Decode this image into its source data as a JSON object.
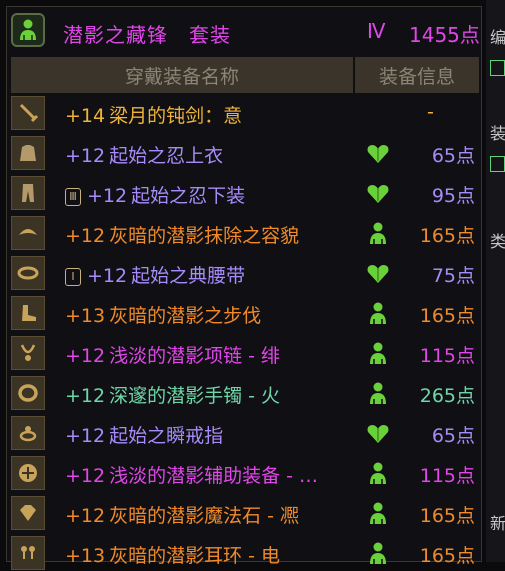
{
  "set": {
    "title": "潜影之藏锋　套装",
    "grade": "Ⅳ",
    "points": "1455点",
    "icon": "green-figure-icon",
    "color": "#e046e8"
  },
  "columns": {
    "name": "穿戴装备名称",
    "info": "装备信息"
  },
  "items": [
    {
      "slot": "weapon",
      "enh": "+14",
      "name": "梁月的钝剑：意",
      "info": "none",
      "points": "-",
      "color": "#f0b33a",
      "pcolor": "#f0b33a"
    },
    {
      "slot": "coat",
      "enh": "+12",
      "name": "起始之忍上衣",
      "info": "heart",
      "points": "65点",
      "color": "#a78bfa",
      "pcolor": "#a78bfa"
    },
    {
      "slot": "pants",
      "lock": "Ⅲ",
      "enh": "+12",
      "name": "起始之忍下装",
      "info": "heart",
      "points": "95点",
      "color": "#a78bfa",
      "pcolor": "#a78bfa"
    },
    {
      "slot": "shoulder",
      "enh": "+12",
      "name": "灰暗的潜影抹除之容貌",
      "info": "figure",
      "points": "165点",
      "color": "#f08a2a",
      "pcolor": "#f08a2a"
    },
    {
      "slot": "belt",
      "lock": "Ⅰ",
      "enh": "+12",
      "name": "起始之典腰带",
      "info": "heart",
      "points": "75点",
      "color": "#a78bfa",
      "pcolor": "#a78bfa"
    },
    {
      "slot": "shoes",
      "enh": "+13",
      "name": "灰暗的潜影之步伐",
      "info": "figure",
      "points": "165点",
      "color": "#f08a2a",
      "pcolor": "#f08a2a"
    },
    {
      "slot": "necklace",
      "enh": "+12",
      "name": "浅淡的潜影项链 - 绯",
      "info": "figure",
      "points": "115点",
      "color": "#e046e8",
      "pcolor": "#e046e8"
    },
    {
      "slot": "bracelet",
      "enh": "+12",
      "name": "深邃的潜影手镯 - 火",
      "info": "figure",
      "points": "265点",
      "color": "#6fd6a8",
      "pcolor": "#6fd6a8"
    },
    {
      "slot": "ring",
      "enh": "+12",
      "name": "起始之瞬戒指",
      "info": "heart",
      "points": "65点",
      "color": "#a78bfa",
      "pcolor": "#a78bfa"
    },
    {
      "slot": "support",
      "enh": "+12",
      "name": "浅淡的潜影辅助装备 - …",
      "info": "figure",
      "points": "115点",
      "color": "#e046e8",
      "pcolor": "#e046e8"
    },
    {
      "slot": "magic-stone",
      "enh": "+12",
      "name": "灰暗的潜影魔法石 - 凞",
      "info": "figure",
      "points": "165点",
      "color": "#f08a2a",
      "pcolor": "#f08a2a"
    },
    {
      "slot": "earring",
      "enh": "+13",
      "name": "灰暗的潜影耳环 - 电",
      "info": "figure",
      "points": "165点",
      "color": "#f08a2a",
      "pcolor": "#f08a2a"
    }
  ],
  "side": {
    "g1": "编",
    "g2": "装",
    "g3": "类",
    "g4": "新"
  }
}
